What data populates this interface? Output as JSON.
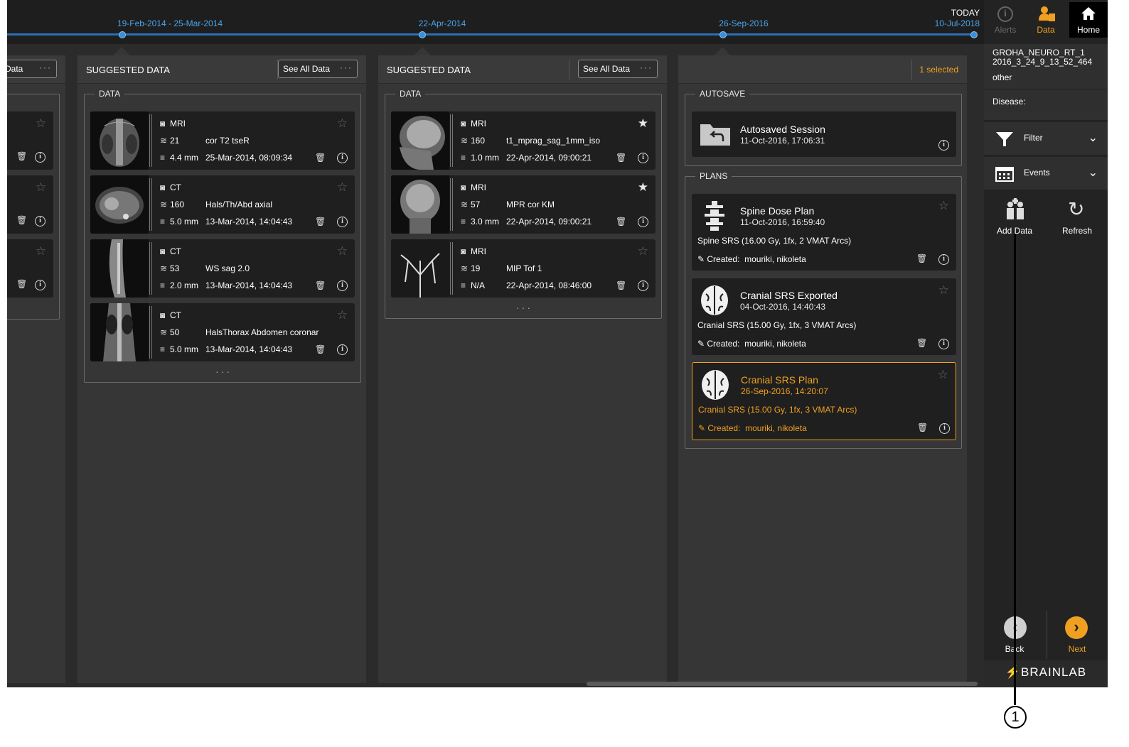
{
  "timeline": {
    "labels": [
      "19-Feb-2014 - 25-Mar-2014",
      "22-Apr-2014",
      "26-Sep-2016"
    ],
    "today_label": "TODAY",
    "today_date": "10-Jul-2018"
  },
  "top_buttons": {
    "alerts": "Alerts",
    "data": "Data",
    "home": "Home"
  },
  "col0": {
    "see_all": "l Data"
  },
  "col1": {
    "title": "SUGGESTED DATA",
    "see_all": "See All Data",
    "section": "DATA",
    "cards": [
      {
        "modality": "MRI",
        "count": "21",
        "name": "cor T2 tseR",
        "thickness": "4.4 mm",
        "date": "25-Mar-2014, 08:09:34"
      },
      {
        "modality": "CT",
        "count": "160",
        "name": "Hals/Th/Abd axial",
        "thickness": "5.0 mm",
        "date": "13-Mar-2014, 14:04:43"
      },
      {
        "modality": "CT",
        "count": "53",
        "name": "WS sag 2.0",
        "thickness": "2.0 mm",
        "date": "13-Mar-2014, 14:04:43"
      },
      {
        "modality": "CT",
        "count": "50",
        "name": "HalsThorax Abdomen coronar",
        "thickness": "5.0 mm",
        "date": "13-Mar-2014, 14:04:43"
      }
    ]
  },
  "col2": {
    "title": "SUGGESTED DATA",
    "see_all": "See All Data",
    "section": "DATA",
    "cards": [
      {
        "modality": "MRI",
        "count": "160",
        "name": "t1_mprag_sag_1mm_iso",
        "thickness": "1.0 mm",
        "date": "22-Apr-2014, 09:00:21"
      },
      {
        "modality": "MRI",
        "count": "57",
        "name": "MPR cor KM",
        "thickness": "3.0 mm",
        "date": "22-Apr-2014, 09:00:21"
      },
      {
        "modality": "MRI",
        "count": "19",
        "name": "MIP Tof 1",
        "thickness": "N/A",
        "date": "22-Apr-2014, 08:46:00"
      }
    ]
  },
  "col3": {
    "selected": "1 selected",
    "autosave_section": "AUTOSAVE",
    "autosave_title": "Autosaved Session",
    "autosave_date": "11-Oct-2016, 17:06:31",
    "plans_section": "PLANS",
    "created_label": "Created:",
    "plans": [
      {
        "title": "Spine Dose Plan",
        "date": "11-Oct-2016, 16:59:40",
        "desc": "Spine SRS (16.00 Gy, 1fx, 2 VMAT Arcs)",
        "author": "mouriki, nikoleta"
      },
      {
        "title": "Cranial SRS Exported",
        "date": "04-Oct-2016, 14:40:43",
        "desc": "Cranial SRS (15.00 Gy, 1fx, 3 VMAT Arcs)",
        "author": "mouriki, nikoleta"
      },
      {
        "title": "Cranial SRS Plan",
        "date": "26-Sep-2016, 14:20:07",
        "desc": "Cranial SRS (15.00 Gy, 1fx, 3 VMAT Arcs)",
        "author": "mouriki, nikoleta"
      }
    ]
  },
  "sidebar": {
    "patient_line1": "GROHA_NEURO_RT_1",
    "patient_line2": "2016_3_24_9_13_52_464",
    "patient_line3": "other",
    "disease": "Disease:",
    "filter": "Filter",
    "events": "Events",
    "add_data": "Add Data",
    "refresh": "Refresh",
    "back": "Back",
    "next": "Next",
    "brand": "BRAINLAB"
  },
  "callout": "1",
  "colors": {
    "accent": "#f0a020",
    "timeline": "#3a8fd9",
    "background": "#2b2b2b"
  }
}
